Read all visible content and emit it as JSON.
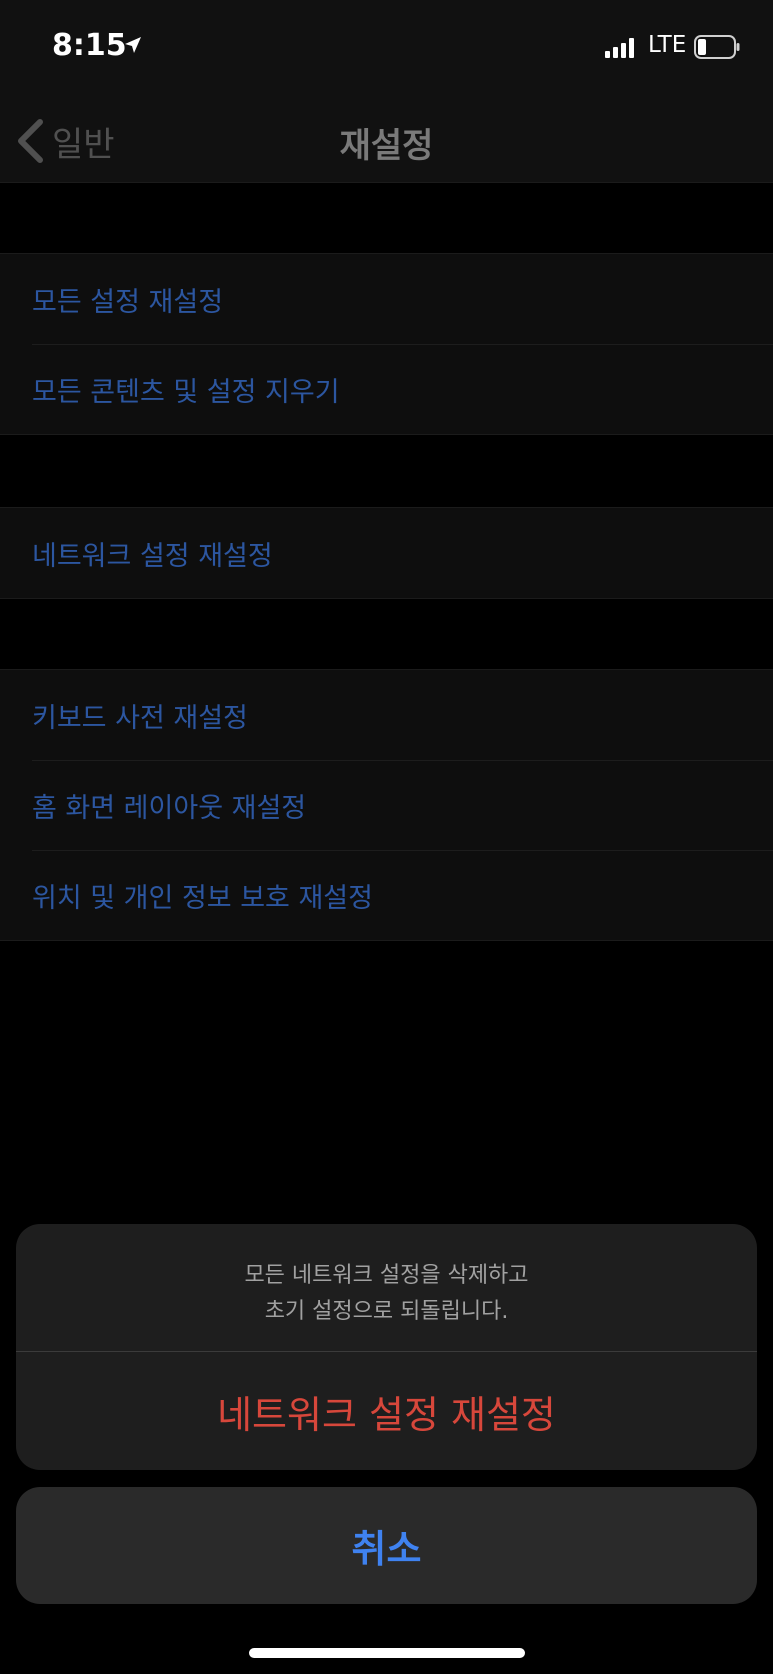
{
  "status_bar": {
    "time": "8:15",
    "network": "LTE",
    "icons": [
      "location-arrow-icon",
      "signal-icon",
      "battery-icon"
    ]
  },
  "nav": {
    "back_label": "일반",
    "title": "재설정",
    "back_icon": "chevron-left-icon"
  },
  "groups": [
    {
      "items": [
        "모든 설정 재설정",
        "모든 콘텐츠 및 설정 지우기"
      ]
    },
    {
      "items": [
        "네트워크 설정 재설정"
      ]
    },
    {
      "items": [
        "키보드 사전 재설정",
        "홈 화면 레이아웃 재설정",
        "위치 및 개인 정보 보호 재설정"
      ]
    }
  ],
  "action_sheet": {
    "message_line1": "모든 네트워크 설정을 삭제하고",
    "message_line2": "초기 설정으로 되돌립니다.",
    "action_label": "네트워크 설정 재설정",
    "cancel_label": "취소"
  },
  "colors": {
    "background": "#000000",
    "list_text": "#2c56a0",
    "destructive": "#d7473b",
    "cancel": "#3f82f0"
  }
}
